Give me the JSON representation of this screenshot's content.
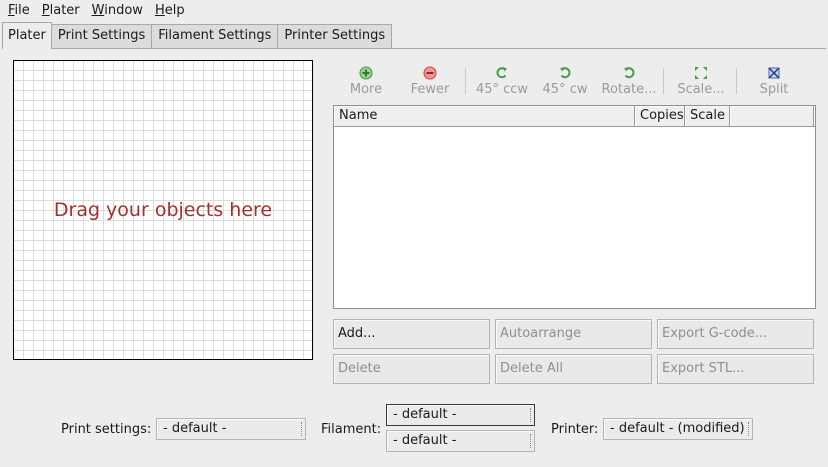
{
  "menu": [
    "File",
    "Plater",
    "Window",
    "Help"
  ],
  "tabs": [
    "Plater",
    "Print Settings",
    "Filament Settings",
    "Printer Settings"
  ],
  "canvas": {
    "hint": "Drag your objects here"
  },
  "toolbar": {
    "more": "More",
    "fewer": "Fewer",
    "rotate_ccw": "45° ccw",
    "rotate_cw": "45° cw",
    "rotate": "Rotate...",
    "scale": "Scale...",
    "split": "Split"
  },
  "object_list": {
    "columns": [
      "Name",
      "Copies",
      "Scale",
      ""
    ],
    "rows": []
  },
  "actions": {
    "add": "Add...",
    "autoarrange": "Autoarrange",
    "export_gcode": "Export G-code...",
    "delete": "Delete",
    "delete_all": "Delete All",
    "export_stl": "Export STL..."
  },
  "presets": {
    "print_label": "Print settings:",
    "print_value": "- default -",
    "filament_label": "Filament:",
    "filament_values": [
      "- default -",
      "- default -"
    ],
    "printer_label": "Printer:",
    "printer_value": "- default - (modified)"
  },
  "colors": {
    "hint_text": "#a03131",
    "add_icon": "#3a9a3a",
    "remove_icon": "#d13c3c",
    "rotate_icon": "#4a9a4a",
    "scale_icon": "#4a9a4a",
    "split_icon": "#4a6ab0"
  }
}
